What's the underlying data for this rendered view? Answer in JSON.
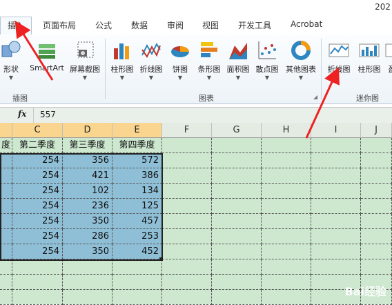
{
  "title_partial": "202",
  "tabs": [
    {
      "label": "插入",
      "active": true
    },
    {
      "label": "页面布局"
    },
    {
      "label": "公式"
    },
    {
      "label": "数据"
    },
    {
      "label": "审阅"
    },
    {
      "label": "视图"
    },
    {
      "label": "开发工具"
    },
    {
      "label": "Acrobat"
    }
  ],
  "ribbon": {
    "illustrations": {
      "group_label": "插图",
      "buttons": [
        {
          "label": "形状",
          "icon": "shapes-icon"
        },
        {
          "label": "SmartArt",
          "icon": "smartart-icon"
        },
        {
          "label": "屏幕截图",
          "icon": "screenshot-icon"
        }
      ]
    },
    "charts": {
      "group_label": "图表",
      "buttons": [
        {
          "label": "柱形图",
          "icon": "column-chart-icon"
        },
        {
          "label": "折线图",
          "icon": "line-chart-icon"
        },
        {
          "label": "饼图",
          "icon": "pie-chart-icon"
        },
        {
          "label": "条形图",
          "icon": "bar-chart-icon"
        },
        {
          "label": "面积图",
          "icon": "area-chart-icon"
        },
        {
          "label": "散点图",
          "icon": "scatter-chart-icon"
        },
        {
          "label": "其他图表",
          "icon": "other-chart-icon"
        }
      ]
    },
    "sparklines": {
      "group_label": "迷你图",
      "buttons": [
        {
          "label": "折线图",
          "icon": "sparkline-line-icon"
        },
        {
          "label": "柱形图",
          "icon": "sparkline-column-icon"
        },
        {
          "label": "盈",
          "icon": "sparkline-winloss-icon"
        }
      ]
    }
  },
  "formula_bar": {
    "fx": "fx",
    "value": "557"
  },
  "columns": [
    "C",
    "D",
    "E",
    "F",
    "G",
    "H",
    "I",
    "J"
  ],
  "header_row": [
    "度",
    "第二季度",
    "第三季度",
    "第四季度"
  ],
  "rows": [
    [
      "254",
      "356",
      "572"
    ],
    [
      "254",
      "421",
      "386"
    ],
    [
      "254",
      "102",
      "134"
    ],
    [
      "254",
      "236",
      "125"
    ],
    [
      "254",
      "350",
      "457"
    ],
    [
      "254",
      "286",
      "253"
    ],
    [
      "254",
      "350",
      "452"
    ]
  ],
  "watermark": "Bai经验"
}
